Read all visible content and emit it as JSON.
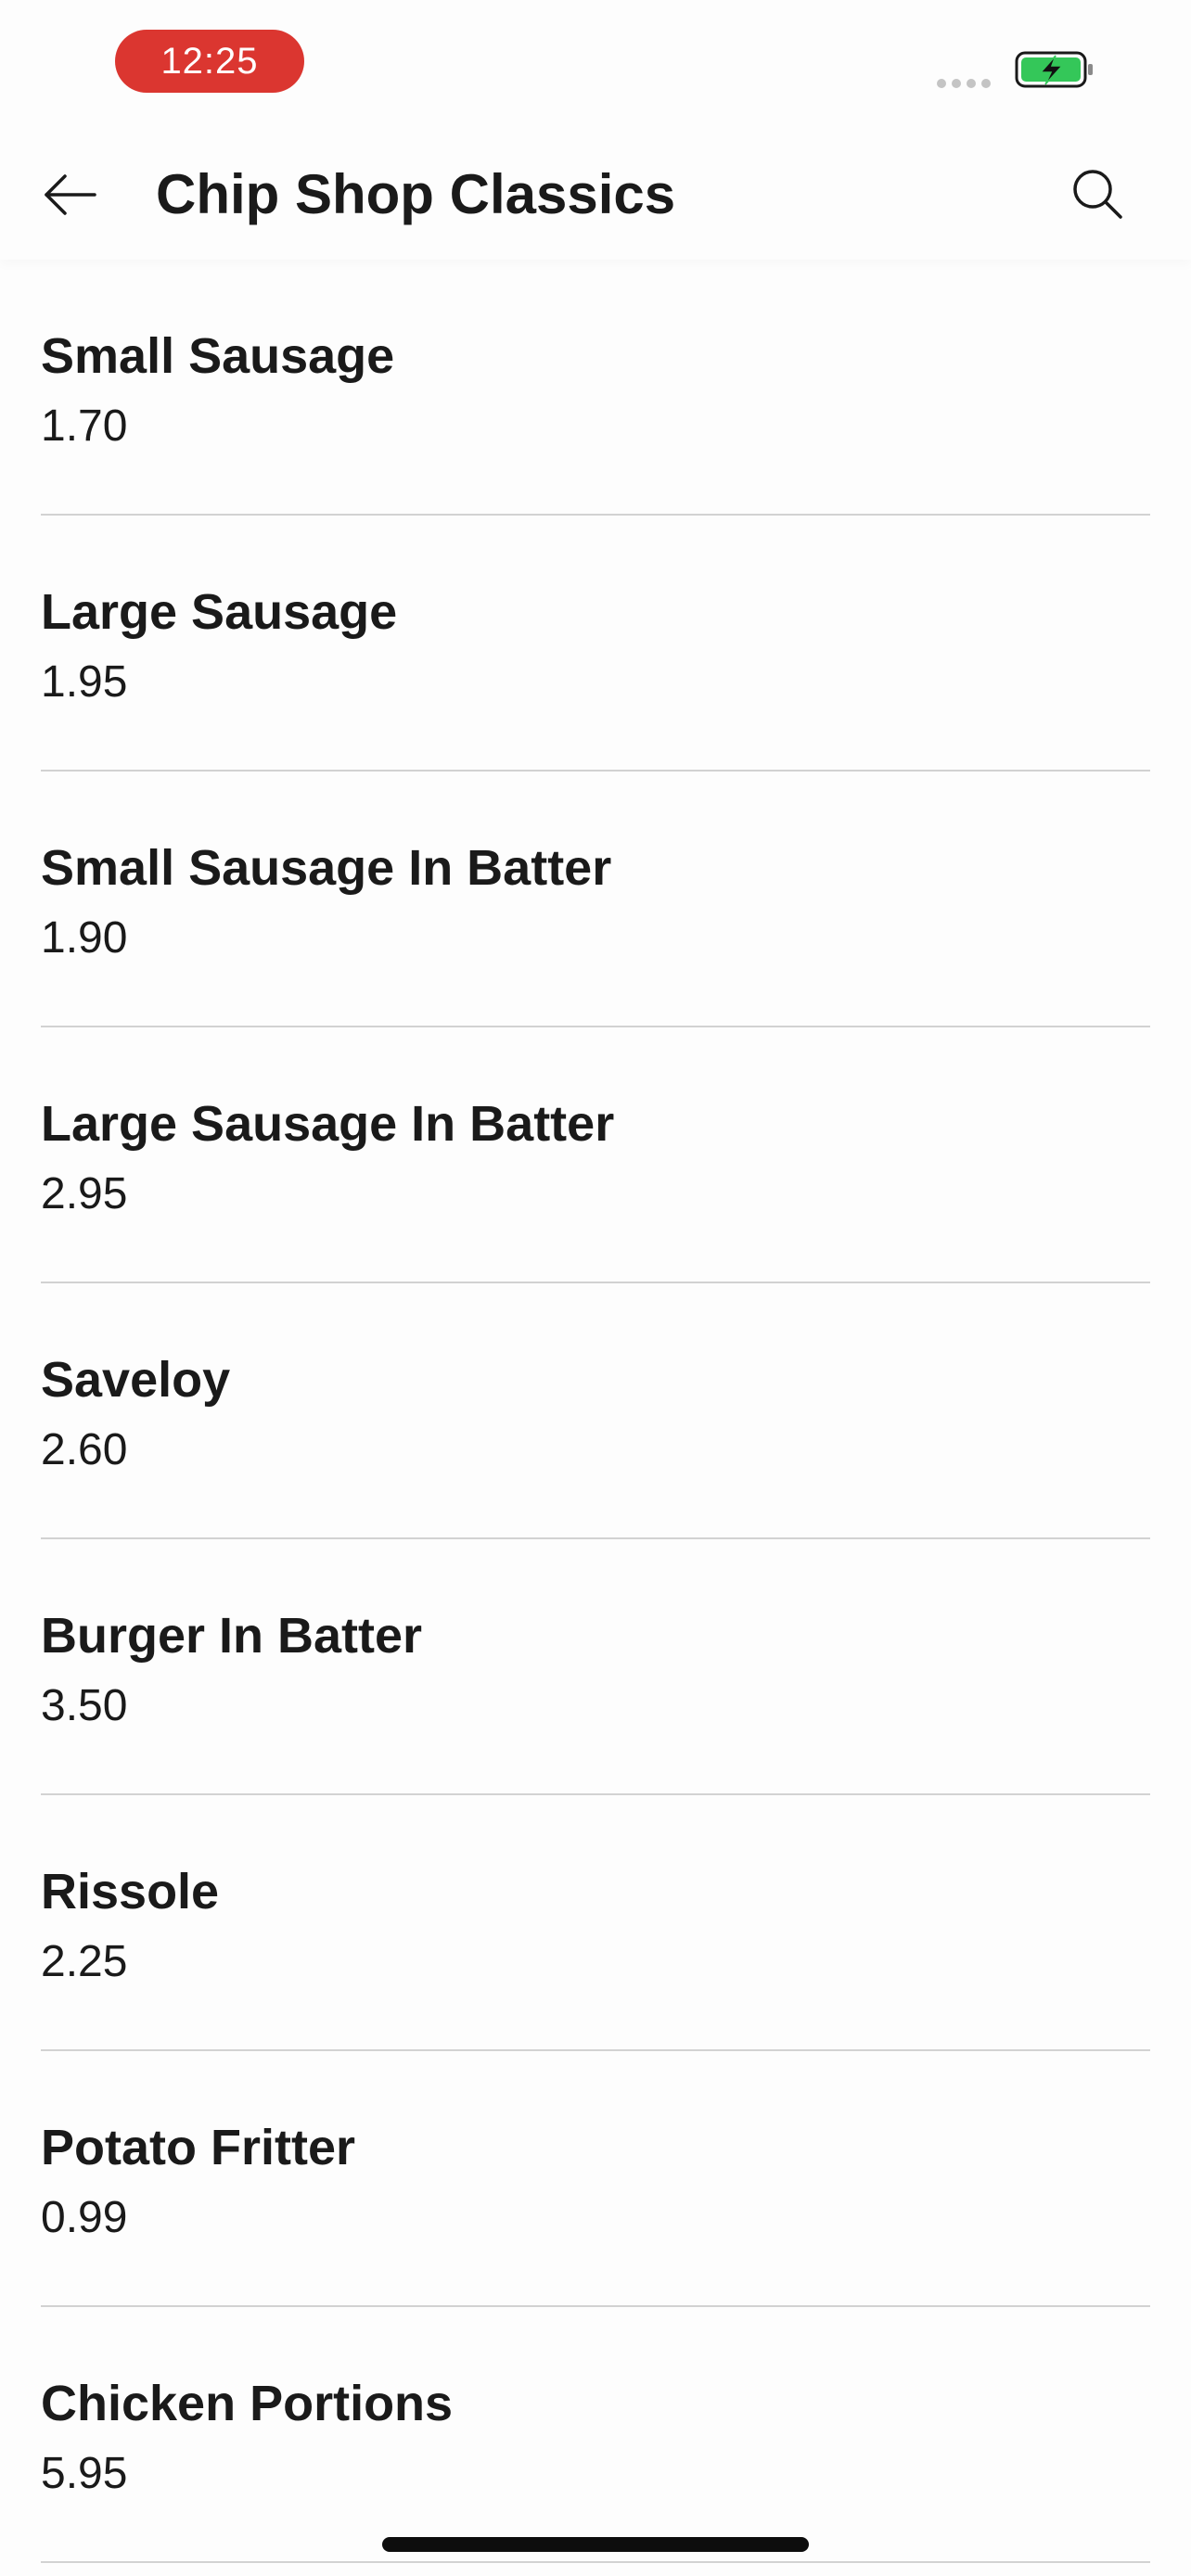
{
  "status_bar": {
    "time": "12:25",
    "time_pill_color": "#db3630",
    "battery_icon": "battery-charging-icon",
    "battery_color": "#34c759",
    "signal_icon": "signal-dots-icon"
  },
  "header": {
    "title": "Chip Shop Classics",
    "back_icon": "arrow-left-icon",
    "search_icon": "search-icon"
  },
  "menu_items": [
    {
      "name": "Small Sausage",
      "price": "1.70"
    },
    {
      "name": "Large Sausage",
      "price": "1.95"
    },
    {
      "name": "Small Sausage In Batter",
      "price": "1.90"
    },
    {
      "name": "Large Sausage In Batter",
      "price": "2.95"
    },
    {
      "name": "Saveloy",
      "price": "2.60"
    },
    {
      "name": "Burger In Batter",
      "price": "3.50"
    },
    {
      "name": "Rissole",
      "price": "2.25"
    },
    {
      "name": "Potato Fritter",
      "price": "0.99"
    },
    {
      "name": "Chicken Portions",
      "price": "5.95"
    }
  ]
}
